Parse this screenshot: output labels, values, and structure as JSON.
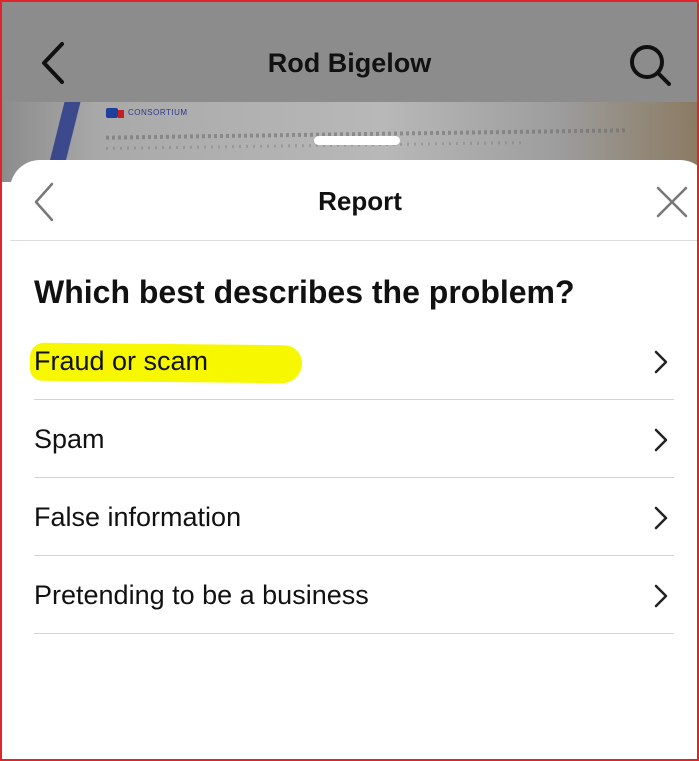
{
  "header": {
    "title": "Rod Bigelow",
    "back_icon": "chevron-left-icon",
    "search_icon": "search-icon"
  },
  "certificate_preview": {
    "logo_text": "CONSORTIUM"
  },
  "sheet": {
    "title": "Report",
    "back_icon": "chevron-left-icon",
    "close_icon": "close-icon",
    "question": "Which best describes the problem?",
    "options": [
      {
        "label": "Fraud or scam",
        "highlighted": true
      },
      {
        "label": "Spam"
      },
      {
        "label": "False information"
      },
      {
        "label": "Pretending to be a business"
      }
    ]
  },
  "colors": {
    "highlight": "#f7f700",
    "overlay": "#8c8c8c",
    "frame_border": "#e0242b"
  }
}
